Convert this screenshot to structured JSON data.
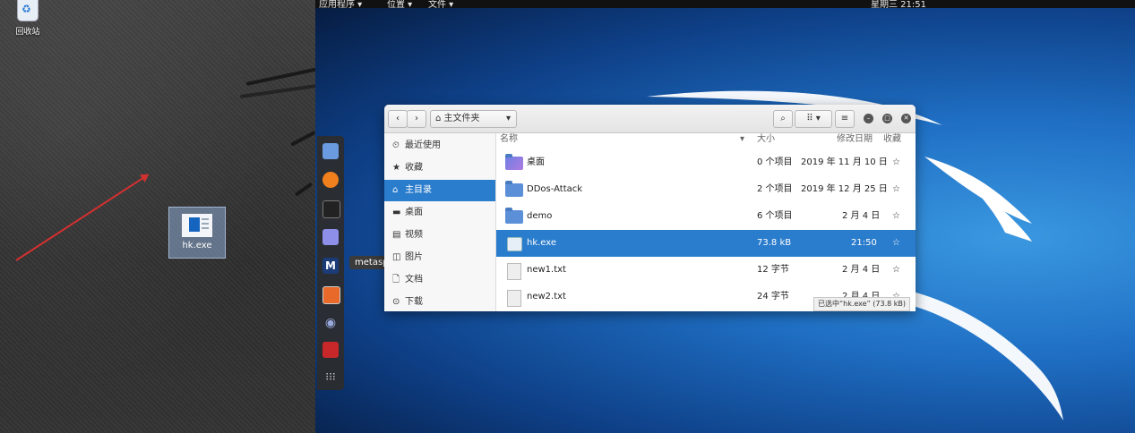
{
  "desktop_left": {
    "recycle_bin_label": "回收站",
    "file_icon_label": "hk.exe"
  },
  "topbar": {
    "applications": "应用程序 ▾",
    "places": "位置 ▾",
    "files": "文件 ▾",
    "clock": "星期三 21:51"
  },
  "dock": {
    "tooltip": "metasploit framework",
    "apps": [
      "files-icon",
      "firefox-icon",
      "terminal-icon",
      "text-editor-icon",
      "metasploit-icon",
      "burpsuite-icon",
      "eye-icon",
      "cherrytree-icon",
      "app-grid-icon"
    ]
  },
  "window": {
    "location": "主文件夹",
    "sidebar": [
      {
        "icon": "⏲",
        "label": "最近使用"
      },
      {
        "icon": "★",
        "label": "收藏"
      },
      {
        "icon": "⌂",
        "label": "主目录"
      },
      {
        "icon": "▬",
        "label": "桌面"
      },
      {
        "icon": "▤",
        "label": "视频"
      },
      {
        "icon": "◫",
        "label": "图片"
      },
      {
        "icon": "🗋",
        "label": "文档"
      },
      {
        "icon": "⊙",
        "label": "下载"
      }
    ],
    "columns": {
      "name": "名称",
      "size": "大小",
      "modified": "修改日期",
      "starred": "收藏"
    },
    "files": [
      {
        "name": "桌面",
        "size": "0 个项目",
        "modified": "2019 年 11 月 10 日",
        "star": "☆"
      },
      {
        "name": "DDos-Attack",
        "size": "2 个项目",
        "modified": "2019 年 12 月 25 日",
        "star": "☆"
      },
      {
        "name": "demo",
        "size": "6 个项目",
        "modified": "2 月 4 日",
        "star": "☆"
      },
      {
        "name": "hk.exe",
        "size": "73.8 kB",
        "modified": "21:50",
        "star": "☆"
      },
      {
        "name": "new1.txt",
        "size": "12 字节",
        "modified": "2 月 4 日",
        "star": "☆"
      },
      {
        "name": "new2.txt",
        "size": "24 字节",
        "modified": "2 月 4 日",
        "star": "☆"
      }
    ],
    "status": "已选中“hk.exe” (73.8 kB)"
  }
}
